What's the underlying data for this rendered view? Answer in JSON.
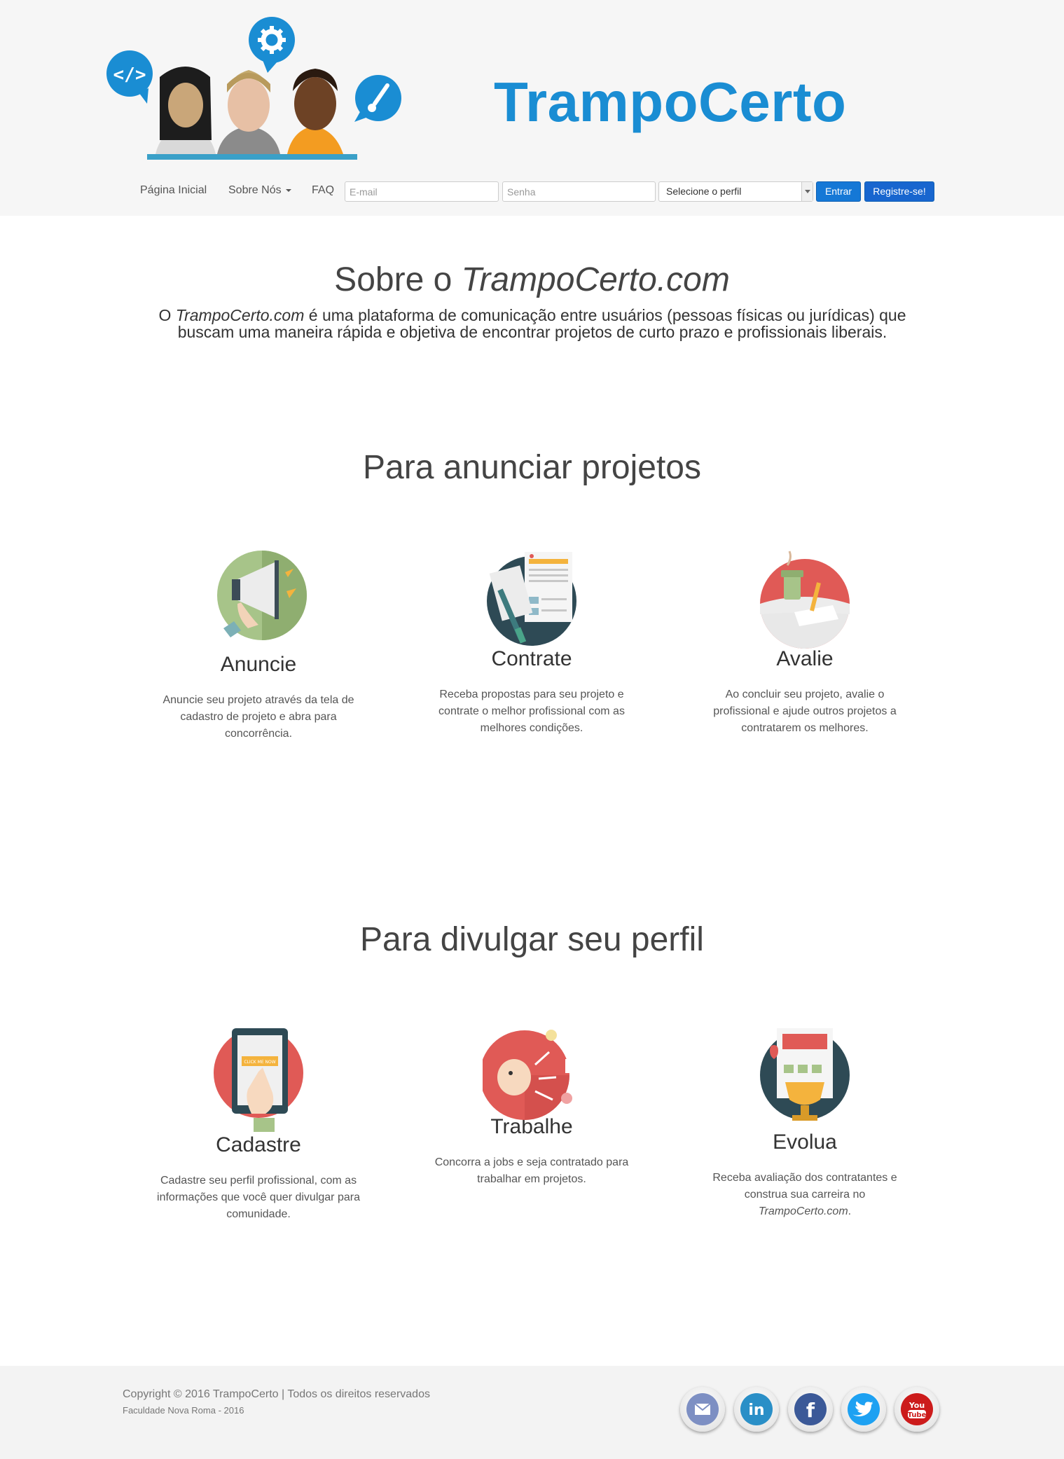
{
  "brand": {
    "name": "TrampoCerto"
  },
  "nav": {
    "home": "Página Inicial",
    "about": "Sobre Nós",
    "faq": "FAQ",
    "email_placeholder": "E-mail",
    "password_placeholder": "Senha",
    "profile_select": "Selecione o perfil",
    "login_button": "Entrar",
    "register_button": "Registre-se!"
  },
  "about": {
    "title_prefix": "Sobre o ",
    "title_site": "TrampoCerto.com",
    "text_site": "TrampoCerto.com",
    "text_prefix": "O ",
    "text_body": " é uma plataforma de comunicação entre usuários (pessoas físicas ou jurídicas) que buscam uma maneira rápida e objetiva de encontrar projetos de curto prazo e profissionais liberais."
  },
  "section_projects": {
    "title": "Para anunciar projetos",
    "features": [
      {
        "title": "Anuncie",
        "text": "Anuncie seu projeto através da tela de cadastro de projeto e abra para concorrência."
      },
      {
        "title": "Contrate",
        "text": "Receba propostas para seu projeto e contrate o melhor profissional com as melhores condições."
      },
      {
        "title": "Avalie",
        "text": "Ao concluir seu projeto, avalie o profissional e ajude outros projetos a contratarem os melhores."
      }
    ]
  },
  "section_profile": {
    "title": "Para divulgar seu perfil",
    "features": [
      {
        "title": "Cadastre",
        "text": "Cadastre seu perfil profissional, com as informações que você quer divulgar para comunidade."
      },
      {
        "title": "Trabalhe",
        "text": "Concorra a jobs e seja contratado para trabalhar em projetos."
      },
      {
        "title": "Evolua",
        "text_prefix": "Receba avaliação dos contratantes e construa sua carreira no ",
        "text_site": "TrampoCerto.com",
        "text_suffix": "."
      }
    ]
  },
  "footer": {
    "copyright": "Copyright © 2016 TrampoCerto | Todos os direitos reservados",
    "school": "Faculdade Nova Roma - 2016",
    "click_here": "CLICK ME NOW",
    "social": [
      "mail-icon",
      "linkedin-icon",
      "facebook-icon",
      "twitter-icon",
      "youtube-icon"
    ]
  },
  "colors": {
    "brand_blue": "#1a8dd3",
    "button_blue": "#1578d6"
  }
}
